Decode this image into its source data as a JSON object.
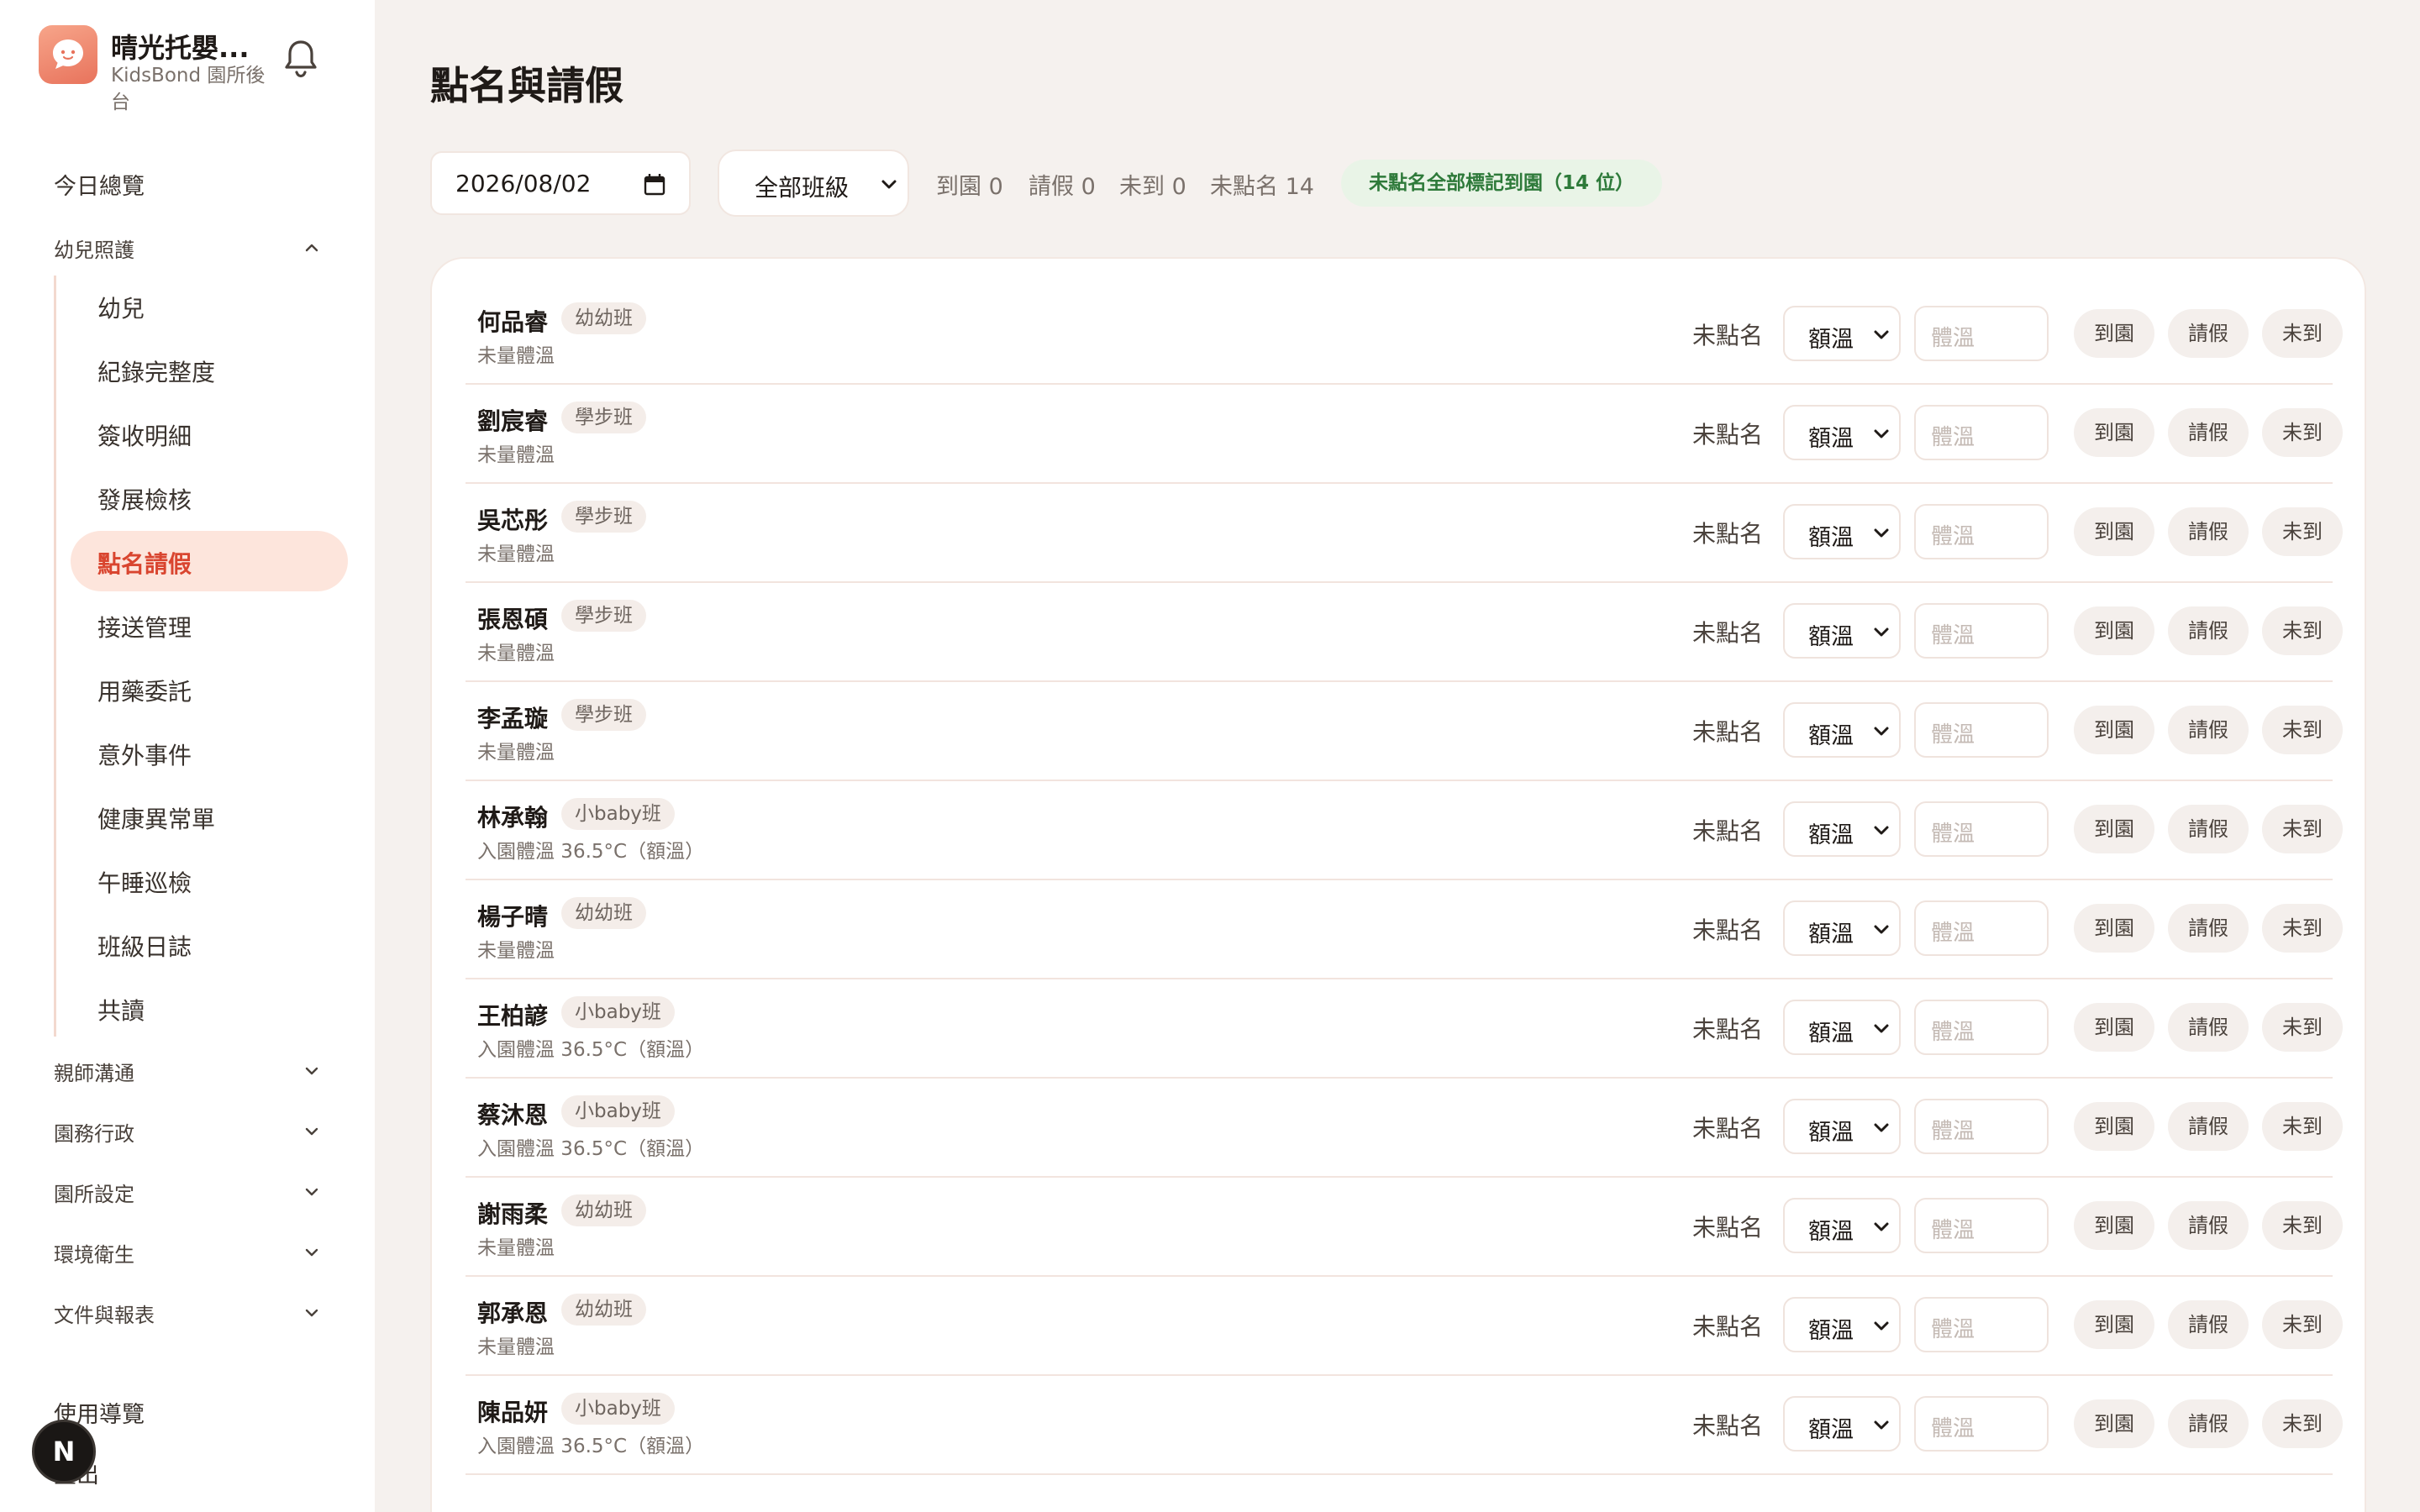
{
  "app": {
    "title": "晴光托嬰...",
    "subtitle": "KidsBond 園所後台",
    "brand_color": "#ef7d60",
    "accent_color": "#d9452f"
  },
  "sidebar": {
    "overview": "今日總覽",
    "groups": {
      "care": "幼兒照護",
      "comm": "親師溝通",
      "admin": "園務行政",
      "settings": "園所設定",
      "hygiene": "環境衛生",
      "docs": "文件與報表"
    },
    "care_items": [
      "幼兒",
      "紀錄完整度",
      "簽收明細",
      "發展檢核",
      "點名請假",
      "接送管理",
      "用藥委託",
      "意外事件",
      "健康異常單",
      "午睡巡檢",
      "班級日誌",
      "共讀"
    ],
    "active_item": "點名請假",
    "guide": "使用導覽",
    "logout": "登出",
    "avatar_letter": "N"
  },
  "page": {
    "title": "點名與請假",
    "date_value": "2026/08/02",
    "class_filter": "全部班級",
    "stats": {
      "arrived": "到園 0",
      "leave": "請假 0",
      "absent": "未到 0",
      "unmarked": "未點名 14"
    },
    "mark_all_button": "未點名全部標記到園（14 位）"
  },
  "row_labels": {
    "status": "未點名",
    "temp_type": "額溫",
    "temp_placeholder": "體溫",
    "btn_arrive": "到園",
    "btn_leave": "請假",
    "btn_absent": "未到"
  },
  "children": [
    {
      "name": "何品睿",
      "class": "幼幼班",
      "note": "未量體溫"
    },
    {
      "name": "劉宸睿",
      "class": "學步班",
      "note": "未量體溫"
    },
    {
      "name": "吳芯彤",
      "class": "學步班",
      "note": "未量體溫"
    },
    {
      "name": "張恩碩",
      "class": "學步班",
      "note": "未量體溫"
    },
    {
      "name": "李孟璇",
      "class": "學步班",
      "note": "未量體溫"
    },
    {
      "name": "林承翰",
      "class": "小baby班",
      "note": "入園體溫 36.5°C（額溫）"
    },
    {
      "name": "楊子晴",
      "class": "幼幼班",
      "note": "未量體溫"
    },
    {
      "name": "王柏諺",
      "class": "小baby班",
      "note": "入園體溫 36.5°C（額溫）"
    },
    {
      "name": "蔡沐恩",
      "class": "小baby班",
      "note": "入園體溫 36.5°C（額溫）"
    },
    {
      "name": "謝雨柔",
      "class": "幼幼班",
      "note": "未量體溫"
    },
    {
      "name": "郭承恩",
      "class": "幼幼班",
      "note": "未量體溫"
    },
    {
      "name": "陳品妍",
      "class": "小baby班",
      "note": "入園體溫 36.5°C（額溫）"
    }
  ]
}
